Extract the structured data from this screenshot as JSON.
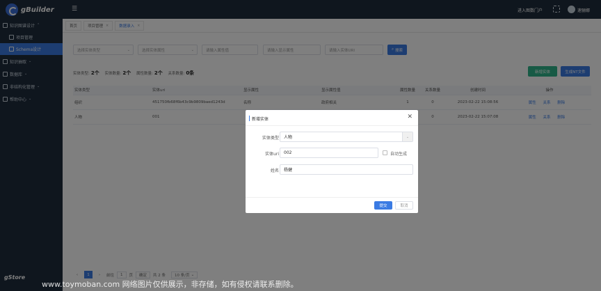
{
  "header": {
    "logo_text": "gBuilder",
    "menu_toggle": "☰",
    "portal_link": "进入图数门户",
    "user_name": "速骊娜"
  },
  "sidebar": {
    "items": [
      {
        "label": "知识图谱设计",
        "expanded": true
      },
      {
        "label": "项目管理",
        "sub": true
      },
      {
        "label": "Schema设计",
        "sub": true,
        "active": true
      },
      {
        "label": "知识抽取"
      },
      {
        "label": "数据库"
      },
      {
        "label": "非结构化管理"
      },
      {
        "label": "帮助中心"
      }
    ],
    "footer_logo": "gStore"
  },
  "tabs": [
    {
      "label": "首页",
      "closable": false
    },
    {
      "label": "项目管理",
      "closable": true
    },
    {
      "label": "数据录入",
      "closable": true,
      "current": true
    }
  ],
  "filters": {
    "entity_type": "选择实体类型",
    "entity_attr": "选择实体属性",
    "attr_value": "请输入属性值",
    "display_attr": "请输入显示属性",
    "entity_uri": "请输入实体URI",
    "search_btn": "搜索"
  },
  "actions": {
    "add_entity": "新增实体",
    "gen_nt": "生成NT文件"
  },
  "stats": {
    "type_label": "实体类型:",
    "type_count": "2个",
    "entity_label": "实体数量:",
    "entity_count": "2个",
    "attr_label": "属性数量:",
    "attr_count": "2个",
    "relation_label": "关系数量:",
    "relation_count": "0条"
  },
  "table": {
    "headers": [
      "实体类型",
      "实体uri",
      "显示属性",
      "显示属性值",
      "属性数量",
      "关系数量",
      "创建时间",
      "操作"
    ],
    "rows": [
      {
        "type": "组织",
        "uri": "451750fb68f6b43c9b9809baed1243d",
        "display_attr": "名称",
        "display_value": "政府相关",
        "attr_count": "1",
        "rel_count": "0",
        "created": "2023-02-22 15:08:56"
      },
      {
        "type": "人物",
        "uri": "001",
        "display_attr": "",
        "display_value": "",
        "attr_count": "1",
        "rel_count": "0",
        "created": "2023-02-22 15:07:08"
      }
    ],
    "ops": [
      "属性",
      "关系",
      "删除"
    ]
  },
  "pager": {
    "prev": "‹",
    "current_page": "1",
    "next": "›",
    "goto_label": "前往",
    "goto_value": "1",
    "page_unit": "页",
    "confirm": "确定",
    "total": "共 2 条",
    "page_size": "10 条/页"
  },
  "modal": {
    "title": "新增实体",
    "close": "✕",
    "type_label": "实体类型",
    "type_value": "人物",
    "uri_label": "实体uri",
    "uri_value": "002",
    "auto_gen_label": "自动生成",
    "name_label": "姓名",
    "name_value": "杨健",
    "submit": "提交",
    "cancel": "取消"
  },
  "watermark": "www.toymoban.com 网络图片仅供展示，非存储，如有侵权请联系删除。",
  "colors": {
    "nav_bg": "#1f2d3d",
    "accent": "#3a7be3",
    "green": "#2fb58a"
  }
}
